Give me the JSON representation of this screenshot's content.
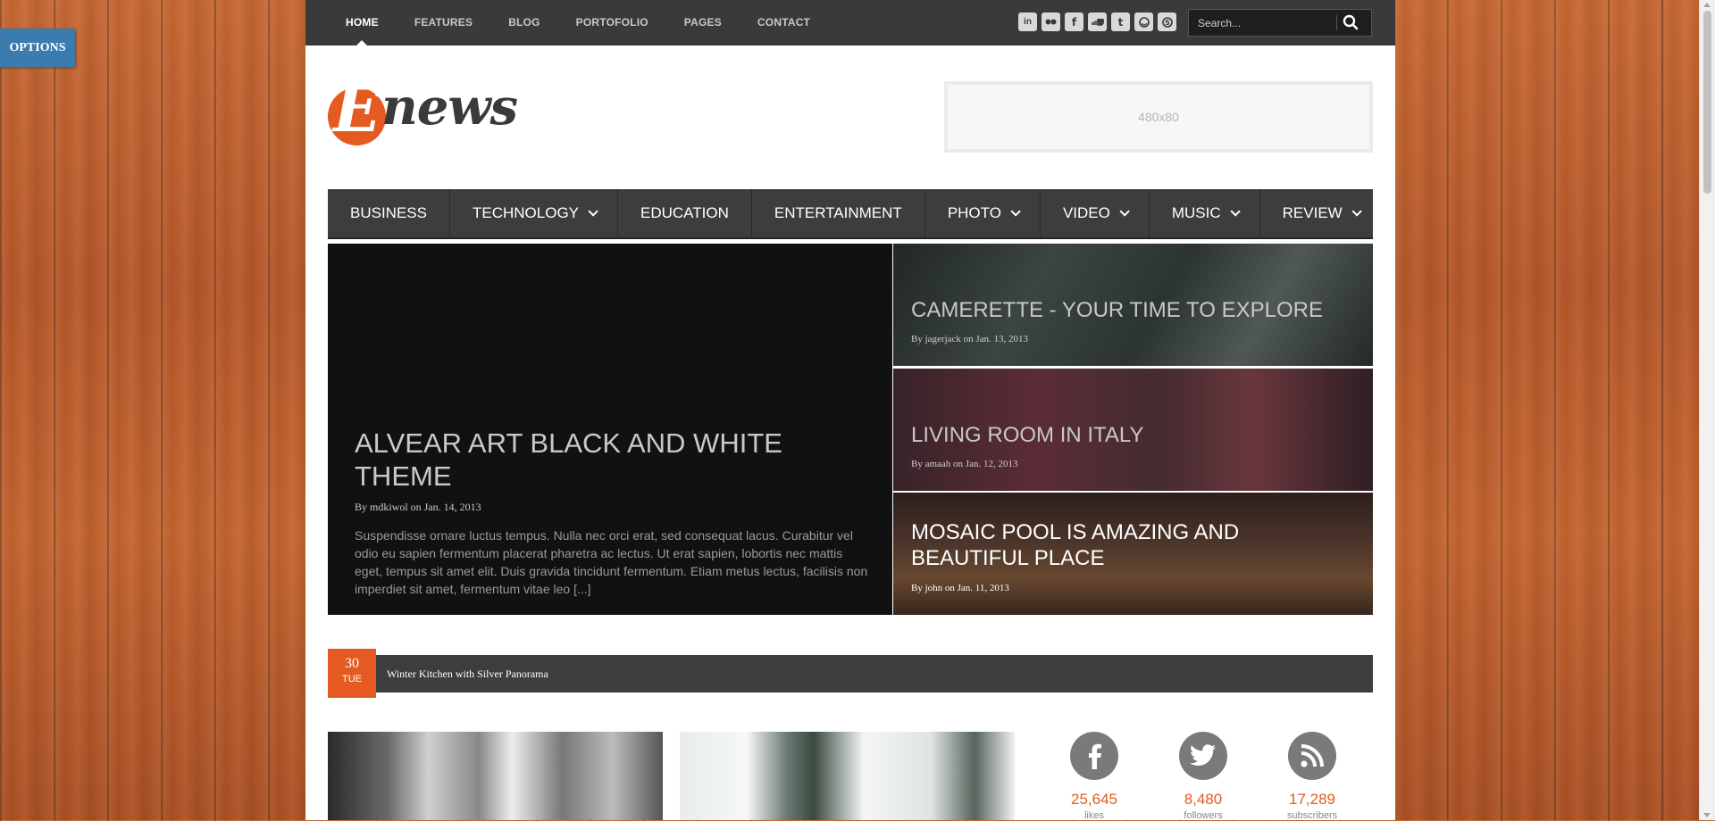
{
  "options_label": "OPTIONS",
  "topnav": {
    "items": [
      "HOME",
      "FEATURES",
      "BLOG",
      "PORTOFOLIO",
      "PAGES",
      "CONTACT"
    ]
  },
  "social_icons": [
    "linkedin-icon",
    "flickr-icon",
    "facebook-icon",
    "soundcloud-icon",
    "tumblr-icon",
    "stumbleupon-icon",
    "skype-icon"
  ],
  "search": {
    "placeholder": "Search..."
  },
  "logo": {
    "initial": "E",
    "rest": "news"
  },
  "ad_label": "480x80",
  "mainnav": [
    {
      "label": "BUSINESS",
      "dropdown": false
    },
    {
      "label": "TECHNOLOGY",
      "dropdown": true
    },
    {
      "label": "EDUCATION",
      "dropdown": false
    },
    {
      "label": "ENTERTAINMENT",
      "dropdown": false
    },
    {
      "label": "PHOTO",
      "dropdown": true
    },
    {
      "label": "VIDEO",
      "dropdown": true
    },
    {
      "label": "MUSIC",
      "dropdown": true
    },
    {
      "label": "REVIEW",
      "dropdown": true
    }
  ],
  "featured_main": {
    "title": "ALVEAR ART BLACK AND WHITE THEME",
    "meta": "By mdkiwol on Jan. 14, 2013",
    "excerpt": "Suspendisse ornare luctus tempus. Nulla nec orci erat, sed consequat lacus. Curabitur vel odio eu sapien fermentum placerat pharetra ac lectus. Ut erat sapien, lobortis nec mattis eget, tempus sit amet elit. Duis gravida tincidunt fermentum. Etiam metus lectus, facilisis non imperdiet sit amet, fermentum vitae leo [...]"
  },
  "featured_side": [
    {
      "title": "CAMERETTE - YOUR TIME TO EXPLORE",
      "meta": "By jagerjack on Jan. 13, 2013"
    },
    {
      "title": "LIVING ROOM IN ITALY",
      "meta": "By amaah on Jan. 12, 2013"
    },
    {
      "title": "MOSAIC POOL IS AMAZING AND BEAUTIFUL PLACE",
      "meta": "By john on Jan. 11, 2013"
    }
  ],
  "ticker": {
    "day": "30",
    "weekday": "TUE",
    "text": "Winter Kitchen with Silver Panorama"
  },
  "social_stats": [
    {
      "icon": "facebook-icon",
      "count": "25,645",
      "label": "likes"
    },
    {
      "icon": "twitter-icon",
      "count": "8,480",
      "label": "followers"
    },
    {
      "icon": "rss-icon",
      "count": "17,289",
      "label": "subscribers"
    }
  ],
  "colors": {
    "accent": "#e55a21",
    "dark_bar": "#3d3d3d",
    "topbar": "#3a3a3a",
    "options": "#3b7cb0"
  }
}
